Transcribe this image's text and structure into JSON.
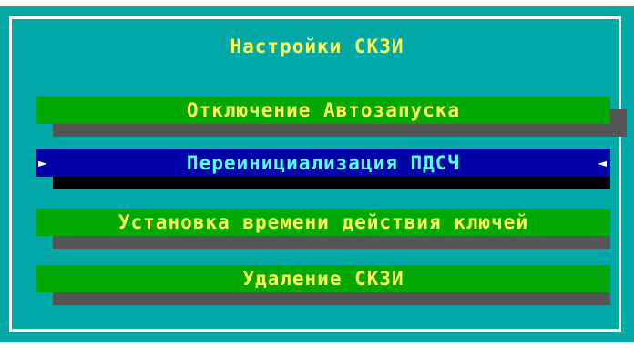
{
  "window": {
    "title": "Настройки СКЗИ"
  },
  "menu": {
    "items": [
      {
        "label": "Отключение Автозапуска",
        "selected": false
      },
      {
        "label": "Переинициализация ПДСЧ",
        "selected": true
      },
      {
        "label": "Установка времени действия ключей",
        "selected": false
      },
      {
        "label": "Удаление СКЗИ",
        "selected": false
      }
    ],
    "selection_markers": {
      "left": "►",
      "right": "◄"
    }
  },
  "colors": {
    "background": "#00a8a8",
    "button": "#00a800",
    "button_selected": "#0000a8",
    "text": "#ffff55",
    "text_selected": "#55ffff",
    "shadow": "#555555",
    "frame": "#ffffff"
  }
}
